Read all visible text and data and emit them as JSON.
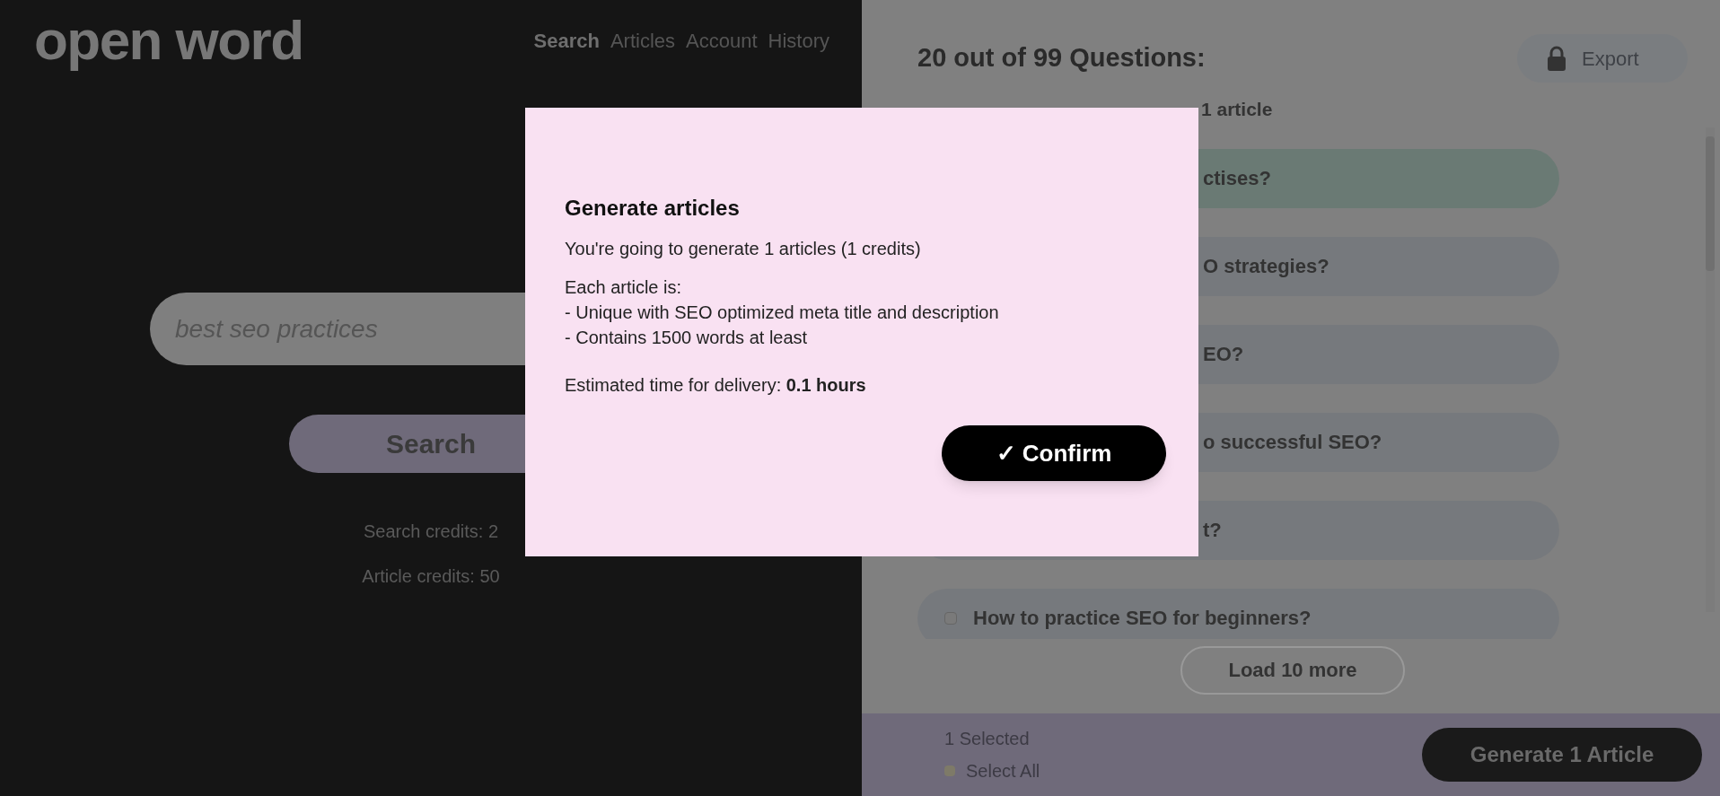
{
  "logo": "open word",
  "nav": [
    {
      "label": "Search",
      "selected": true
    },
    {
      "label": "Articles",
      "selected": false
    },
    {
      "label": "Account",
      "selected": false
    },
    {
      "label": "History",
      "selected": false
    }
  ],
  "search": {
    "value": "best seo practices",
    "button": "Search",
    "credits": [
      "Search credits: 2",
      "Article credits: 50"
    ]
  },
  "questions": {
    "title": "20 out of 99 Questions:",
    "export": "Export",
    "subtitle": "1 article",
    "items": [
      {
        "text": "ctises?",
        "selected": true,
        "kind": "partial"
      },
      {
        "text": "O strategies?",
        "selected": false,
        "kind": "partial"
      },
      {
        "text": "EO?",
        "selected": false,
        "kind": "partial"
      },
      {
        "text": "o successful SEO?",
        "selected": false,
        "kind": "partial"
      },
      {
        "text": "t?",
        "selected": false,
        "kind": "partial"
      },
      {
        "text": "How to practice SEO for beginners?",
        "selected": false,
        "kind": "full"
      }
    ],
    "load_more": "Load 10 more"
  },
  "footer": {
    "selected_count": "1 Selected",
    "select_all": {
      "label": "Select All",
      "checked": false
    },
    "generate": "Generate 1 Article"
  },
  "dialog": {
    "title": "Generate articles",
    "summary": "You're going to generate 1 articles (1 credits)",
    "details": [
      "Each article is:",
      "- Unique with SEO optimized meta title and description",
      "- Contains 1500 words at least"
    ],
    "estimate": "Estimated time for delivery: **0.1 hours**",
    "confirm": "✓ Confirm"
  }
}
